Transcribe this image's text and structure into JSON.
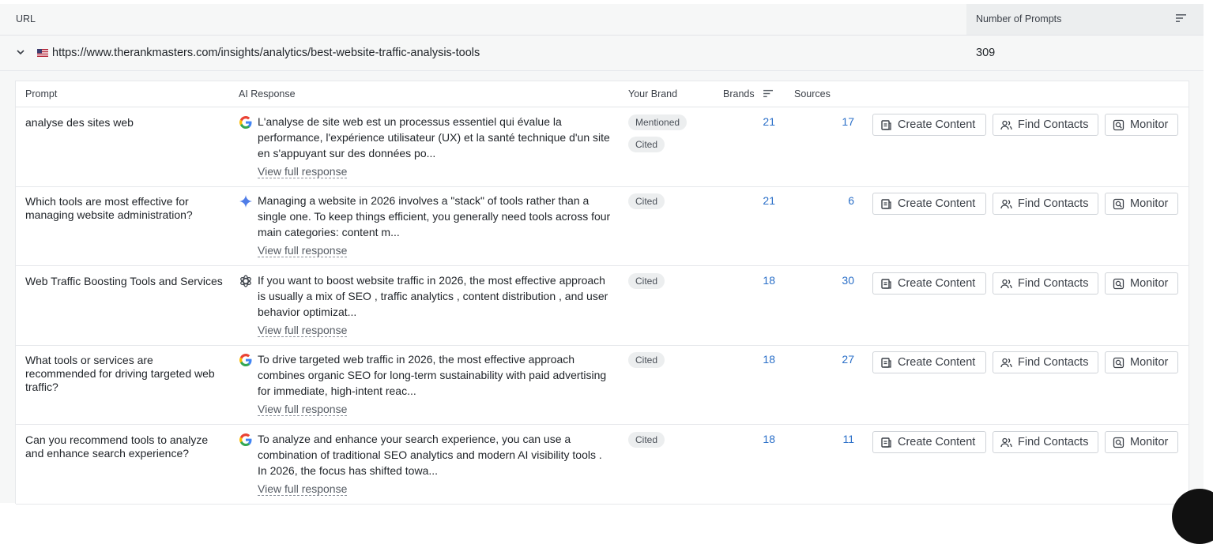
{
  "outer_header": {
    "url_label": "URL",
    "prompts_label": "Number of Prompts"
  },
  "url_row": {
    "url": "https://www.therankmasters.com/insights/analytics/best-website-traffic-analysis-tools",
    "prompt_count": "309",
    "flag_icon": "us-flag-icon",
    "expand_icon": "chevron-down-icon"
  },
  "inner_header": {
    "prompt": "Prompt",
    "ai_response": "AI Response",
    "your_brand": "Your Brand",
    "brands": "Brands",
    "sources": "Sources"
  },
  "actions": {
    "create": "Create Content",
    "contacts": "Find Contacts",
    "monitor": "Monitor"
  },
  "view_full": "View full response",
  "colors": {
    "link_blue": "#2a6fc8",
    "header_bg": "#f6f7f7",
    "badge_bg": "#eceeef"
  },
  "rows": [
    {
      "prompt": "analyse des sites web",
      "engine_icon": "google-icon",
      "response": "L'analyse de site web est un processus essentiel qui évalue la performance, l'expérience utilisateur (UX) et la santé technique d'un site en s'appuyant sur des données po...",
      "badges": [
        "Mentioned",
        "Cited"
      ],
      "brands": "21",
      "sources": "17"
    },
    {
      "prompt": "Which tools are most effective for managing website administration?",
      "engine_icon": "gemini-icon",
      "response": "Managing a website in 2026 involves a \"stack\" of tools rather than a single one. To keep things efficient, you generally need tools across four main categories: content m...",
      "badges": [
        "Cited"
      ],
      "brands": "21",
      "sources": "6"
    },
    {
      "prompt": "Web Traffic Boosting Tools and Services",
      "engine_icon": "openai-icon",
      "response": "If you want to boost website traffic in 2026, the most effective approach is usually a mix of SEO , traffic analytics , content distribution , and user behavior optimizat...",
      "badges": [
        "Cited"
      ],
      "brands": "18",
      "sources": "30"
    },
    {
      "prompt": "What tools or services are recommended for driving targeted web traffic?",
      "engine_icon": "google-icon",
      "response": "To drive targeted web traffic in 2026, the most effective approach combines organic SEO for long-term sustainability with paid advertising for immediate, high-intent reac...",
      "badges": [
        "Cited"
      ],
      "brands": "18",
      "sources": "27"
    },
    {
      "prompt": "Can you recommend tools to analyze and enhance search experience?",
      "engine_icon": "google-icon",
      "response": "To analyze and enhance your search experience, you can use a combination of traditional SEO analytics and modern AI visibility tools . In 2026, the focus has shifted towa...",
      "badges": [
        "Cited"
      ],
      "brands": "18",
      "sources": "11"
    }
  ]
}
